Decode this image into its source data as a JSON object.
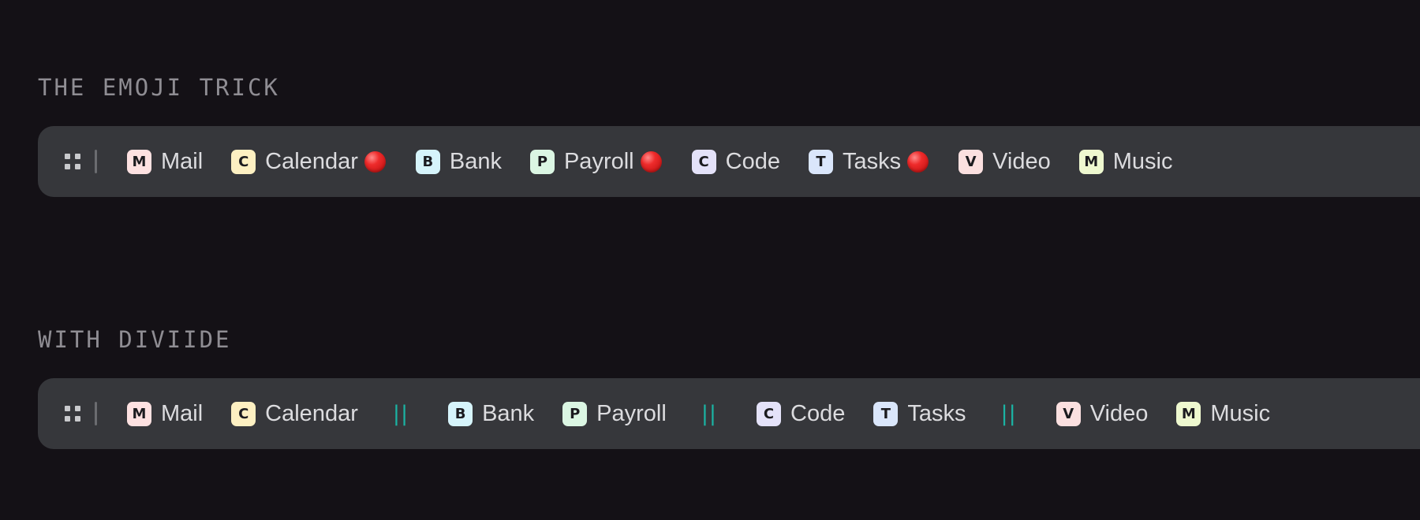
{
  "sections": [
    {
      "title": "THE EMOJI TRICK",
      "apps": [
        {
          "letter": "M",
          "label": "Mail",
          "badge_color": "#fde1e1",
          "dot": false
        },
        {
          "letter": "C",
          "label": "Calendar",
          "badge_color": "#fdf0c2",
          "dot": true
        },
        {
          "letter": "B",
          "label": "Bank",
          "badge_color": "#d6f4fb",
          "dot": false
        },
        {
          "letter": "P",
          "label": "Payroll",
          "badge_color": "#dbf6e3",
          "dot": true
        },
        {
          "letter": "C",
          "label": "Code",
          "badge_color": "#e4e2f9",
          "dot": false
        },
        {
          "letter": "T",
          "label": "Tasks",
          "badge_color": "#dae6fb",
          "dot": true
        },
        {
          "letter": "V",
          "label": "Video",
          "badge_color": "#fbe0e0",
          "dot": false
        },
        {
          "letter": "M",
          "label": "Music",
          "badge_color": "#eef8cf",
          "dot": false
        }
      ],
      "indicator": "red-circle-emoji",
      "indicator_color": "#e02222"
    },
    {
      "title": "WITH DIVIIDE",
      "apps": [
        {
          "letter": "M",
          "label": "Mail",
          "badge_color": "#fde1e1",
          "sep_after": false
        },
        {
          "letter": "C",
          "label": "Calendar",
          "badge_color": "#fdf0c2",
          "sep_after": true
        },
        {
          "letter": "B",
          "label": "Bank",
          "badge_color": "#d6f4fb",
          "sep_after": false
        },
        {
          "letter": "P",
          "label": "Payroll",
          "badge_color": "#dbf6e3",
          "sep_after": true
        },
        {
          "letter": "C",
          "label": "Code",
          "badge_color": "#e4e2f9",
          "sep_after": false
        },
        {
          "letter": "T",
          "label": "Tasks",
          "badge_color": "#dae6fb",
          "sep_after": true
        },
        {
          "letter": "V",
          "label": "Video",
          "badge_color": "#fbe0e0",
          "sep_after": false
        },
        {
          "letter": "M",
          "label": "Music",
          "badge_color": "#eef8cf",
          "sep_after": false
        }
      ],
      "separator_glyph": "||",
      "separator_color": "#1bb3a3"
    }
  ],
  "icons": {
    "grip": "grip-icon",
    "divider": "vertical-divider"
  },
  "colors": {
    "background": "#141116",
    "bar": "#36373b",
    "title": "#8f8d93",
    "label": "#dcdcdf"
  }
}
